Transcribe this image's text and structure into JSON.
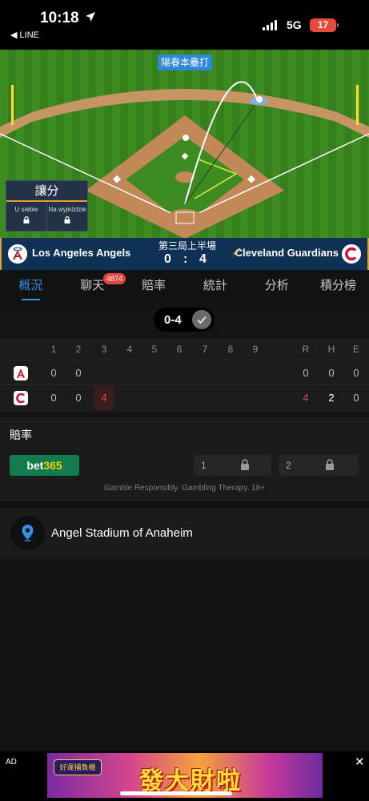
{
  "status_bar": {
    "time": "10:18",
    "back_app": "◀ LINE",
    "network": "5G",
    "battery": "17"
  },
  "field": {
    "play_label": "陽春本壘打",
    "handicap": {
      "title": "讓分",
      "options": [
        "U siebie",
        "Na wyjeździe"
      ]
    }
  },
  "scoreboard": {
    "home_team": "Los Angeles Angels",
    "away_team": "Cleveland Guardians",
    "inning": "第三局上半場",
    "home_score": "0",
    "separator": ":",
    "away_score": "4",
    "colors": {
      "angels": "#c4122e",
      "guardians": "#c6123f",
      "accent": "#e2a02c"
    }
  },
  "tabs": {
    "items": [
      "概況",
      "聊天",
      "賠率",
      "統計",
      "分析",
      "積分榜"
    ],
    "active": "概況",
    "chat_badge": "4874"
  },
  "summary": {
    "score": "0-4"
  },
  "linescore": {
    "headers": [
      "1",
      "2",
      "3",
      "4",
      "5",
      "6",
      "7",
      "8",
      "9",
      "R",
      "H",
      "E"
    ],
    "rows": [
      {
        "team": "angels",
        "innings": [
          "0",
          "0",
          "",
          "",
          "",
          "",
          "",
          "",
          ""
        ],
        "r": "0",
        "h": "0",
        "e": "0"
      },
      {
        "team": "guardians",
        "innings": [
          "0",
          "0",
          "4",
          "",
          "",
          "",
          "",
          "",
          ""
        ],
        "r": "4",
        "h": "2",
        "e": "0"
      }
    ]
  },
  "odds": {
    "title": "賠率",
    "bookmaker": {
      "part1": "bet",
      "part2": "365"
    },
    "option1": "1",
    "option2": "2",
    "disclaimer": "Gamble Responsibly. Gambling Therapy. 18+"
  },
  "venue": {
    "name": "Angel Stadium of Anaheim"
  },
  "ad": {
    "label": "AD",
    "close": "✕",
    "banner_text": "發大財啦",
    "banner_logo": "好運捕魚機"
  }
}
